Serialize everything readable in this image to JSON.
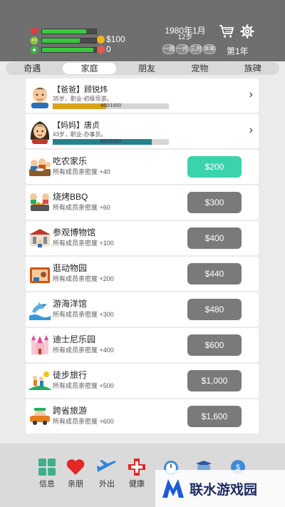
{
  "header": {
    "money": "$100",
    "gems": "0",
    "date": "1980年1月",
    "age": "12岁",
    "speed_buttons": [
      "一周",
      "一月",
      "三月",
      "半年"
    ],
    "year": "第1年",
    "stats": [
      {
        "name": "health",
        "color": "#e43b3b",
        "fill": 0.82
      },
      {
        "name": "mood",
        "color": "#39c93e",
        "fill": 0.7
      },
      {
        "name": "energy",
        "color": "#39c93e",
        "fill": 0.95
      }
    ]
  },
  "tabs": [
    {
      "label": "奇遇",
      "active": false
    },
    {
      "label": "家庭",
      "active": true
    },
    {
      "label": "朋友",
      "active": false
    },
    {
      "label": "宠物",
      "active": false
    },
    {
      "label": "族碑",
      "active": false
    }
  ],
  "family": [
    {
      "name": "【爸爸】顾锐炜",
      "desc": "35岁，职业-初级导游。",
      "intimacy": "460/1000",
      "fill": 0.46,
      "color": "#d9a21c"
    },
    {
      "name": "【妈妈】唐贞",
      "desc": "43岁，职业-办事员。",
      "intimacy": "850/1000",
      "fill": 0.85,
      "color": "#248093"
    }
  ],
  "activities": [
    {
      "name": "吃农家乐",
      "desc": "所有成员亲密度 +40",
      "price": "$200",
      "affordable": true
    },
    {
      "name": "烧烤BBQ",
      "desc": "所有成员亲密度 +60",
      "price": "$300",
      "affordable": false
    },
    {
      "name": "参观博物馆",
      "desc": "所有成员亲密度 +100",
      "price": "$400",
      "affordable": false
    },
    {
      "name": "逛动物园",
      "desc": "所有成员亲密度 +200",
      "price": "$440",
      "affordable": false
    },
    {
      "name": "游海洋馆",
      "desc": "所有成员亲密度 +300",
      "price": "$480",
      "affordable": false
    },
    {
      "name": "迪士尼乐园",
      "desc": "所有成员亲密度 +400",
      "price": "$600",
      "affordable": false
    },
    {
      "name": "徒步旅行",
      "desc": "所有成员亲密度 +500",
      "price": "$1,000",
      "affordable": false
    },
    {
      "name": "跨省旅游",
      "desc": "所有成员亲密度 +600",
      "price": "$1,600",
      "affordable": false
    }
  ],
  "bottom_nav": [
    {
      "label": "信息",
      "icon": "plus-grid-icon"
    },
    {
      "label": "亲朋",
      "icon": "heart-icon"
    },
    {
      "label": "外出",
      "icon": "airplane-icon"
    },
    {
      "label": "健康",
      "icon": "medical-cross-icon"
    },
    {
      "label": "",
      "icon": "alarm-clock-icon"
    },
    {
      "label": "",
      "icon": "book-icon"
    },
    {
      "label": "",
      "icon": "money-icon"
    }
  ],
  "watermark": "联水游戏园",
  "colors": {
    "header": "#6f6f6f",
    "affordable": "#3ad3ae",
    "disabled": "#7a7a7a"
  }
}
